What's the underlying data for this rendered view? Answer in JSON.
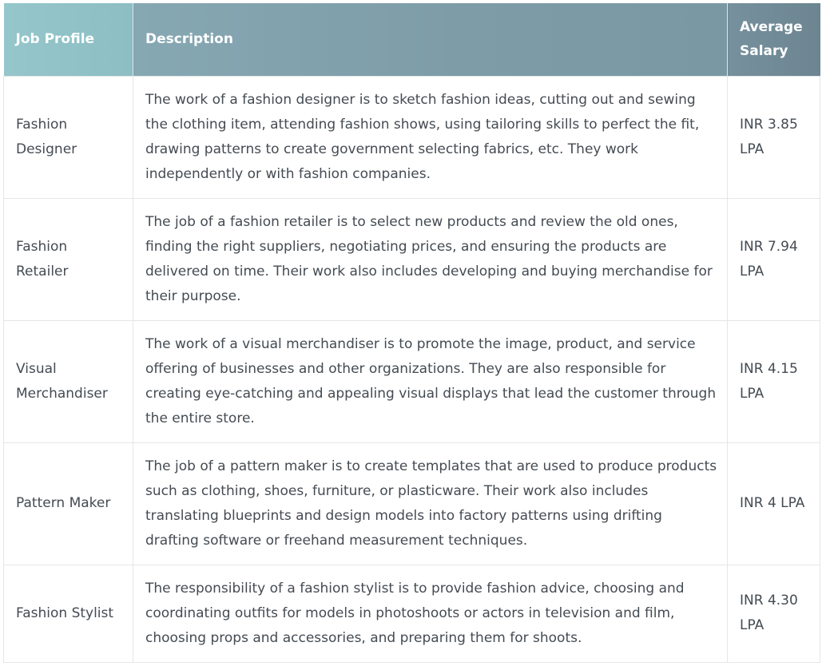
{
  "table": {
    "headers": {
      "profile": "Job Profile",
      "description": "Description",
      "salary": "Average Salary"
    },
    "rows": [
      {
        "profile": "Fashion Designer",
        "description": "The work of a fashion designer is to sketch fashion ideas, cutting out and sewing the clothing item, attending fashion shows, using tailoring skills to perfect the fit, drawing patterns to create government selecting fabrics, etc. They work independently or with fashion companies.",
        "salary": "INR 3.85 LPA"
      },
      {
        "profile": "Fashion Retailer",
        "description": "The job of a fashion retailer is to select new products and review the old ones, finding the right suppliers, negotiating prices, and ensuring the products are delivered on time. Their work also includes developing and buying merchandise for their purpose.",
        "salary": "INR 7.94 LPA"
      },
      {
        "profile": "Visual Merchandiser",
        "description": "The work of a visual merchandiser is to promote the image, product, and service offering of businesses and other organizations. They are also responsible for creating eye-catching and appealing visual displays that lead the customer through the entire store.",
        "salary": "INR 4.15 LPA"
      },
      {
        "profile": "Pattern Maker",
        "description": "The job of a pattern maker is to create templates that are used to produce products such as clothing, shoes, furniture, or plasticware. Their work also includes translating blueprints and design models into factory patterns using drifting drafting software or freehand measurement techniques.",
        "salary": "INR 4 LPA"
      },
      {
        "profile": "Fashion Stylist",
        "description": "The responsibility of a fashion stylist is to provide fashion advice, choosing and coordinating outfits for models in photoshoots or actors in television and film, choosing props and accessories, and preparing them for shoots.",
        "salary": "INR 4.30 LPA"
      }
    ]
  }
}
